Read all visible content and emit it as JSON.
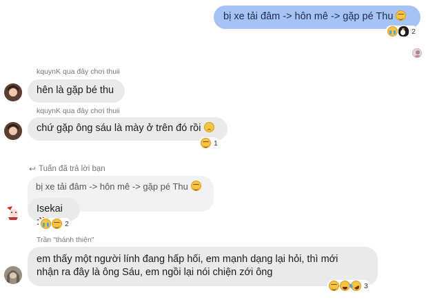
{
  "messages": {
    "outgoing": {
      "text": "bị xe tải đâm -> hôn mê -> gặp pé Thu",
      "reactions": {
        "emojis": [
          "crying-face-emoji",
          "penguin-emoji"
        ],
        "count": "2"
      }
    },
    "msg1": {
      "sender": "kquynK qua đây chơi thuii",
      "text": "hên là gặp bé thu"
    },
    "msg2": {
      "sender": "kquynK qua đây chơi thuii",
      "text": "chứ gặp ông sáu là mày ở trên đó rồi",
      "reactions": {
        "emojis": [
          "relieved-face-emoji"
        ],
        "count": "1"
      }
    },
    "reply": {
      "header": "Tuấn đã trả lời bạn",
      "quoted": "bị xe tải đâm -> hôn mê -> gặp pé Thu",
      "text": "Isekai :))",
      "reactions": {
        "emojis": [
          "crying-face-emoji",
          "relieved-face-emoji"
        ],
        "count": "2"
      }
    },
    "msg4": {
      "sender": "Trần \"thánh thiện\"",
      "line1": "em thấy một người lính đang hấp hối, em mạnh dạng lại hỏi, thì mới",
      "line2": "nhận ra đây là ông Sáu, em ngồi lại nói chiện zới ông",
      "reactions": {
        "emojis": [
          "relieved-face-emoji",
          "grinning-face-emoji",
          "rofl-face-emoji"
        ],
        "count": "3"
      }
    }
  },
  "colors": {
    "outgoing_bubble": "#a5c3f5",
    "incoming_bubble": "#eaeaea"
  }
}
